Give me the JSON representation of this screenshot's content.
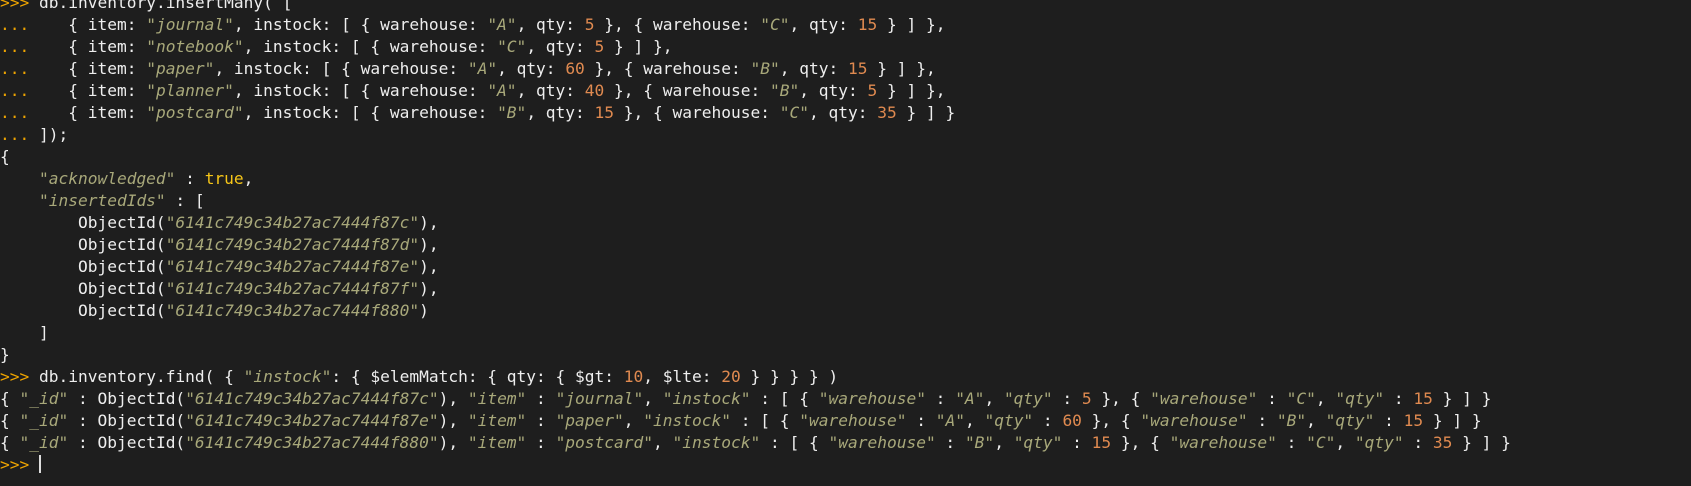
{
  "colors": {
    "background": "#1e1e1e",
    "text": "#eeeeee",
    "prompt": "#f0a500",
    "string": "#a8a87a",
    "number": "#e08a50",
    "keyword": "#f5c518"
  },
  "lines": [
    [
      {
        "t": "p",
        "v": ">>>"
      },
      {
        "t": "x",
        "v": " db.inventory.insertMany( ["
      }
    ],
    [
      {
        "t": "p",
        "v": "..."
      },
      {
        "t": "x",
        "v": "    { item: "
      },
      {
        "t": "s",
        "v": "\"journal\""
      },
      {
        "t": "x",
        "v": ", instock: [ { warehouse: "
      },
      {
        "t": "s",
        "v": "\"A\""
      },
      {
        "t": "x",
        "v": ", qty: "
      },
      {
        "t": "n",
        "v": "5"
      },
      {
        "t": "x",
        "v": " }, { warehouse: "
      },
      {
        "t": "s",
        "v": "\"C\""
      },
      {
        "t": "x",
        "v": ", qty: "
      },
      {
        "t": "n",
        "v": "15"
      },
      {
        "t": "x",
        "v": " } ] },"
      }
    ],
    [
      {
        "t": "p",
        "v": "..."
      },
      {
        "t": "x",
        "v": "    { item: "
      },
      {
        "t": "s",
        "v": "\"notebook\""
      },
      {
        "t": "x",
        "v": ", instock: [ { warehouse: "
      },
      {
        "t": "s",
        "v": "\"C\""
      },
      {
        "t": "x",
        "v": ", qty: "
      },
      {
        "t": "n",
        "v": "5"
      },
      {
        "t": "x",
        "v": " } ] },"
      }
    ],
    [
      {
        "t": "p",
        "v": "..."
      },
      {
        "t": "x",
        "v": "    { item: "
      },
      {
        "t": "s",
        "v": "\"paper\""
      },
      {
        "t": "x",
        "v": ", instock: [ { warehouse: "
      },
      {
        "t": "s",
        "v": "\"A\""
      },
      {
        "t": "x",
        "v": ", qty: "
      },
      {
        "t": "n",
        "v": "60"
      },
      {
        "t": "x",
        "v": " }, { warehouse: "
      },
      {
        "t": "s",
        "v": "\"B\""
      },
      {
        "t": "x",
        "v": ", qty: "
      },
      {
        "t": "n",
        "v": "15"
      },
      {
        "t": "x",
        "v": " } ] },"
      }
    ],
    [
      {
        "t": "p",
        "v": "..."
      },
      {
        "t": "x",
        "v": "    { item: "
      },
      {
        "t": "s",
        "v": "\"planner\""
      },
      {
        "t": "x",
        "v": ", instock: [ { warehouse: "
      },
      {
        "t": "s",
        "v": "\"A\""
      },
      {
        "t": "x",
        "v": ", qty: "
      },
      {
        "t": "n",
        "v": "40"
      },
      {
        "t": "x",
        "v": " }, { warehouse: "
      },
      {
        "t": "s",
        "v": "\"B\""
      },
      {
        "t": "x",
        "v": ", qty: "
      },
      {
        "t": "n",
        "v": "5"
      },
      {
        "t": "x",
        "v": " } ] },"
      }
    ],
    [
      {
        "t": "p",
        "v": "..."
      },
      {
        "t": "x",
        "v": "    { item: "
      },
      {
        "t": "s",
        "v": "\"postcard\""
      },
      {
        "t": "x",
        "v": ", instock: [ { warehouse: "
      },
      {
        "t": "s",
        "v": "\"B\""
      },
      {
        "t": "x",
        "v": ", qty: "
      },
      {
        "t": "n",
        "v": "15"
      },
      {
        "t": "x",
        "v": " }, { warehouse: "
      },
      {
        "t": "s",
        "v": "\"C\""
      },
      {
        "t": "x",
        "v": ", qty: "
      },
      {
        "t": "n",
        "v": "35"
      },
      {
        "t": "x",
        "v": " } ] }"
      }
    ],
    [
      {
        "t": "p",
        "v": "..."
      },
      {
        "t": "x",
        "v": " ]);"
      }
    ],
    [
      {
        "t": "x",
        "v": "{"
      }
    ],
    [
      {
        "t": "x",
        "v": "    "
      },
      {
        "t": "s",
        "v": "\"acknowledged\""
      },
      {
        "t": "x",
        "v": " : "
      },
      {
        "t": "k",
        "v": "true"
      },
      {
        "t": "x",
        "v": ","
      }
    ],
    [
      {
        "t": "x",
        "v": "    "
      },
      {
        "t": "s",
        "v": "\"insertedIds\""
      },
      {
        "t": "x",
        "v": " : ["
      }
    ],
    [
      {
        "t": "x",
        "v": "        ObjectId("
      },
      {
        "t": "s",
        "v": "\"6141c749c34b27ac7444f87c\""
      },
      {
        "t": "x",
        "v": "),"
      }
    ],
    [
      {
        "t": "x",
        "v": "        ObjectId("
      },
      {
        "t": "s",
        "v": "\"6141c749c34b27ac7444f87d\""
      },
      {
        "t": "x",
        "v": "),"
      }
    ],
    [
      {
        "t": "x",
        "v": "        ObjectId("
      },
      {
        "t": "s",
        "v": "\"6141c749c34b27ac7444f87e\""
      },
      {
        "t": "x",
        "v": "),"
      }
    ],
    [
      {
        "t": "x",
        "v": "        ObjectId("
      },
      {
        "t": "s",
        "v": "\"6141c749c34b27ac7444f87f\""
      },
      {
        "t": "x",
        "v": "),"
      }
    ],
    [
      {
        "t": "x",
        "v": "        ObjectId("
      },
      {
        "t": "s",
        "v": "\"6141c749c34b27ac7444f880\""
      },
      {
        "t": "x",
        "v": ")"
      }
    ],
    [
      {
        "t": "x",
        "v": "    ]"
      }
    ],
    [
      {
        "t": "x",
        "v": "}"
      }
    ],
    [
      {
        "t": "p",
        "v": ">>>"
      },
      {
        "t": "x",
        "v": " db.inventory.find( { "
      },
      {
        "t": "s",
        "v": "\"instock\""
      },
      {
        "t": "x",
        "v": ": { $elemMatch: { qty: { $gt: "
      },
      {
        "t": "n",
        "v": "10"
      },
      {
        "t": "x",
        "v": ", $lte: "
      },
      {
        "t": "n",
        "v": "20"
      },
      {
        "t": "x",
        "v": " } } } } )"
      }
    ],
    [
      {
        "t": "x",
        "v": "{ "
      },
      {
        "t": "s",
        "v": "\"_id\""
      },
      {
        "t": "x",
        "v": " : ObjectId("
      },
      {
        "t": "s",
        "v": "\"6141c749c34b27ac7444f87c\""
      },
      {
        "t": "x",
        "v": "), "
      },
      {
        "t": "s",
        "v": "\"item\""
      },
      {
        "t": "x",
        "v": " : "
      },
      {
        "t": "s",
        "v": "\"journal\""
      },
      {
        "t": "x",
        "v": ", "
      },
      {
        "t": "s",
        "v": "\"instock\""
      },
      {
        "t": "x",
        "v": " : [ { "
      },
      {
        "t": "s",
        "v": "\"warehouse\""
      },
      {
        "t": "x",
        "v": " : "
      },
      {
        "t": "s",
        "v": "\"A\""
      },
      {
        "t": "x",
        "v": ", "
      },
      {
        "t": "s",
        "v": "\"qty\""
      },
      {
        "t": "x",
        "v": " : "
      },
      {
        "t": "n",
        "v": "5"
      },
      {
        "t": "x",
        "v": " }, { "
      },
      {
        "t": "s",
        "v": "\"warehouse\""
      },
      {
        "t": "x",
        "v": " : "
      },
      {
        "t": "s",
        "v": "\"C\""
      },
      {
        "t": "x",
        "v": ", "
      },
      {
        "t": "s",
        "v": "\"qty\""
      },
      {
        "t": "x",
        "v": " : "
      },
      {
        "t": "n",
        "v": "15"
      },
      {
        "t": "x",
        "v": " } ] }"
      }
    ],
    [
      {
        "t": "x",
        "v": "{ "
      },
      {
        "t": "s",
        "v": "\"_id\""
      },
      {
        "t": "x",
        "v": " : ObjectId("
      },
      {
        "t": "s",
        "v": "\"6141c749c34b27ac7444f87e\""
      },
      {
        "t": "x",
        "v": "), "
      },
      {
        "t": "s",
        "v": "\"item\""
      },
      {
        "t": "x",
        "v": " : "
      },
      {
        "t": "s",
        "v": "\"paper\""
      },
      {
        "t": "x",
        "v": ", "
      },
      {
        "t": "s",
        "v": "\"instock\""
      },
      {
        "t": "x",
        "v": " : [ { "
      },
      {
        "t": "s",
        "v": "\"warehouse\""
      },
      {
        "t": "x",
        "v": " : "
      },
      {
        "t": "s",
        "v": "\"A\""
      },
      {
        "t": "x",
        "v": ", "
      },
      {
        "t": "s",
        "v": "\"qty\""
      },
      {
        "t": "x",
        "v": " : "
      },
      {
        "t": "n",
        "v": "60"
      },
      {
        "t": "x",
        "v": " }, { "
      },
      {
        "t": "s",
        "v": "\"warehouse\""
      },
      {
        "t": "x",
        "v": " : "
      },
      {
        "t": "s",
        "v": "\"B\""
      },
      {
        "t": "x",
        "v": ", "
      },
      {
        "t": "s",
        "v": "\"qty\""
      },
      {
        "t": "x",
        "v": " : "
      },
      {
        "t": "n",
        "v": "15"
      },
      {
        "t": "x",
        "v": " } ] }"
      }
    ],
    [
      {
        "t": "x",
        "v": "{ "
      },
      {
        "t": "s",
        "v": "\"_id\""
      },
      {
        "t": "x",
        "v": " : ObjectId("
      },
      {
        "t": "s",
        "v": "\"6141c749c34b27ac7444f880\""
      },
      {
        "t": "x",
        "v": "), "
      },
      {
        "t": "s",
        "v": "\"item\""
      },
      {
        "t": "x",
        "v": " : "
      },
      {
        "t": "s",
        "v": "\"postcard\""
      },
      {
        "t": "x",
        "v": ", "
      },
      {
        "t": "s",
        "v": "\"instock\""
      },
      {
        "t": "x",
        "v": " : [ { "
      },
      {
        "t": "s",
        "v": "\"warehouse\""
      },
      {
        "t": "x",
        "v": " : "
      },
      {
        "t": "s",
        "v": "\"B\""
      },
      {
        "t": "x",
        "v": ", "
      },
      {
        "t": "s",
        "v": "\"qty\""
      },
      {
        "t": "x",
        "v": " : "
      },
      {
        "t": "n",
        "v": "15"
      },
      {
        "t": "x",
        "v": " }, { "
      },
      {
        "t": "s",
        "v": "\"warehouse\""
      },
      {
        "t": "x",
        "v": " : "
      },
      {
        "t": "s",
        "v": "\"C\""
      },
      {
        "t": "x",
        "v": ", "
      },
      {
        "t": "s",
        "v": "\"qty\""
      },
      {
        "t": "x",
        "v": " : "
      },
      {
        "t": "n",
        "v": "35"
      },
      {
        "t": "x",
        "v": " } ] }"
      }
    ],
    [
      {
        "t": "p",
        "v": ">>>"
      },
      {
        "t": "x",
        "v": " "
      },
      {
        "t": "c",
        "v": ""
      }
    ]
  ]
}
